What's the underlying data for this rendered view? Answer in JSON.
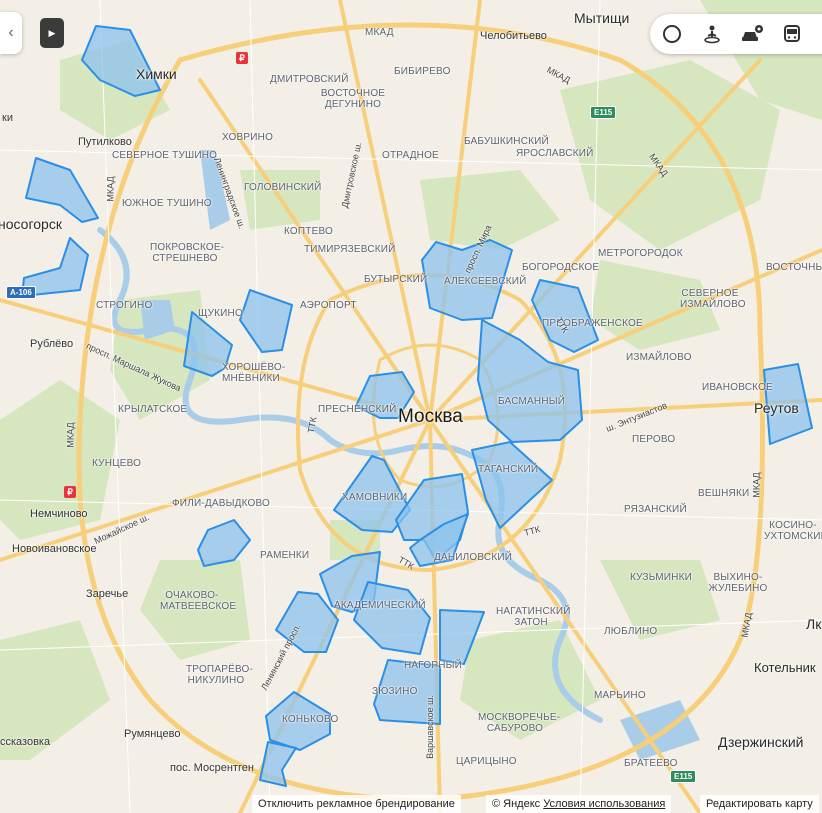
{
  "map_labels": {
    "moscow": "Москва",
    "cities": [
      "Мытищи",
      "Химки",
      "Реутов",
      "носогорск",
      "Котельник",
      "Дзержинский",
      "Лк"
    ],
    "towns": [
      "Путилково",
      "Рублёво",
      "Немчиново",
      "Новоивановское",
      "Заречье",
      "Румянцево",
      "пос. Мосрентген",
      "Челобитьево",
      "ссказовка",
      "ки"
    ],
    "districts": [
      "МКАД",
      "ДМИТРОВСКИЙ",
      "ВОСТОЧНОЕ ДЕГУНИНО",
      "БИБИРЕВО",
      "ХОВРИНО",
      "СЕВЕРНОЕ ТУШИНО",
      "ГОЛОВИНСКИЙ",
      "ОТРАДНОЕ",
      "БАБУШКИНСКИЙ",
      "ЯРОСЛАВСКИЙ",
      "ЮЖНОЕ ТУШИНО",
      "КОПТЕВО",
      "ТИМИРЯЗЕВСКИЙ",
      "ПОКРОВСКОЕ-СТРЕШНЕВО",
      "БУТЫРСКИЙ",
      "АЛЕКСЕЕВСКИЙ",
      "БОГОРОДСКОЕ",
      "МЕТРОГОРОДОК",
      "ВОСТОЧНЫЙ",
      "СТРОГИНО",
      "ЩУКИНО",
      "АЭРОПОРТ",
      "СЕВЕРНОЕ ИЗМАЙЛОВО",
      "ПРЕОБРАЖЕНСКОЕ",
      "ХОРОШЁВО-МНЁВНИКИ",
      "ИЗМАЙЛОВО",
      "КРЫЛАТСКОЕ",
      "ПРЕСНЕНСКИЙ",
      "БАСМАННЫЙ",
      "ИВАНОВСКОЕ",
      "ПЕРОВО",
      "КУНЦЕВО",
      "ТАГАНСКИЙ",
      "ФИЛИ-ДАВЫДКОВО",
      "ХАМОВНИКИ",
      "ВЕШНЯКИ",
      "РЯЗАНСКИЙ",
      "КОСИНО-УХТОМСКИЙ",
      "РАМЕНКИ",
      "ДАНИЛОВСКИЙ",
      "КУЗЬМИНКИ",
      "ВЫХИНО-ЖУЛЕБИНО",
      "ОЧАКОВО-МАТВЕЕВСКОЕ",
      "АКАДЕМИЧЕСКИЙ",
      "НАГАТИНСКИЙ ЗАТОН",
      "ЛЮБЛИНО",
      "ТРОПАРЁВО-НИКУЛИНО",
      "НАГОРНЫЙ",
      "МАРЬИНО",
      "ЗЮЗИНО",
      "МОСКВОРЕЧЬЕ-САБУРОВО",
      "КОНЬКОВО",
      "ЦАРИЦЫНО",
      "БРАТЕЕВО"
    ],
    "roads": [
      "МКАД",
      "МКАД",
      "МКАД",
      "МКАД",
      "МКАД",
      "МКАД",
      "ТТК",
      "ТТК",
      "ТТК",
      "ТТК",
      "Дмитровское ш.",
      "Ленинградское ш.",
      "просп. Мира",
      "просп. Маршала Жукова",
      "ш. Энтузиастов",
      "Можайское ш.",
      "Ленинский просп.",
      "Варшавское ш."
    ]
  },
  "shields": [
    "E115",
    "E115",
    "A-106"
  ],
  "metro_badge": "₽",
  "toolbar": {
    "icons": [
      "layers-icon",
      "panorama-icon",
      "traffic-icon",
      "transit-icon"
    ]
  },
  "footer": {
    "branding_link": "Отключить рекламное брендирование",
    "copyright": "© Яндекс",
    "terms_link": "Условия использования",
    "edit_link": "Редактировать карту"
  },
  "colors": {
    "polygon_fill": "#8cc3ee",
    "polygon_stroke": "#2a8fe6",
    "road_major": "#f6c86a",
    "water": "#a9cde8",
    "park": "#cfe2b5"
  }
}
